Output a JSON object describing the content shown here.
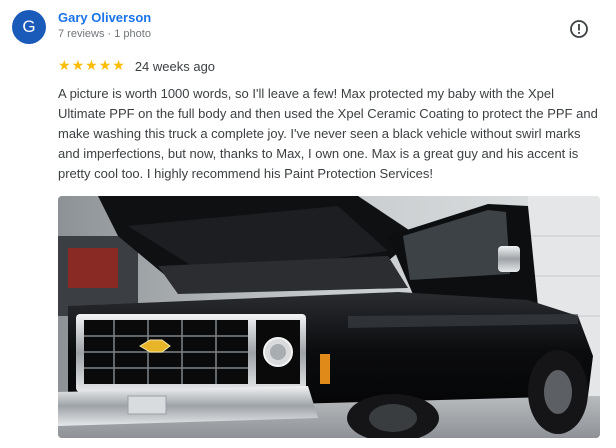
{
  "reviewer": {
    "initial": "G",
    "name": "Gary Oliverson",
    "meta": "7 reviews · 1 photo",
    "avatar_color": "#1a5ab8"
  },
  "review": {
    "rating": 5,
    "star_glyph": "★",
    "star_color": "#fbbc04",
    "date": "24 weeks ago",
    "text": "A picture is worth 1000 words, so I'll leave a few! Max protected my baby with the Xpel Ultimate PPF on the full body and then used the Xpel Ceramic Coating to protect the PPF and make washing this truck a complete joy. I've never seen a black vehicle without swirl marks and imperfections, but now, thanks to Max, I own one. Max is a great guy and his accent is pretty cool too. I highly recommend his Paint Protection Services!"
  },
  "actions": {
    "report_icon": "alert-circle-icon"
  },
  "photo": {
    "subject": "black pickup truck with open hood"
  }
}
